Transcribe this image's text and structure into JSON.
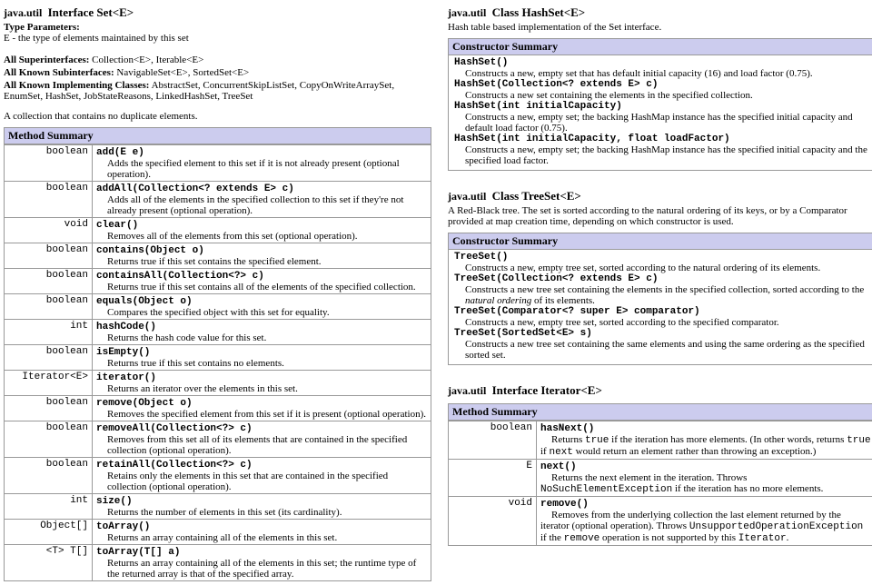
{
  "left": {
    "pkg": "java.util",
    "kind": "Interface",
    "name": "Set<E>",
    "typeParamLabel": "Type Parameters:",
    "typeParam": "E - the type of elements maintained by this set",
    "superLabel": "All Superinterfaces:",
    "superVal": "Collection<E>, Iterable<E>",
    "subLabel": "All Known Subinterfaces:",
    "subVal": "NavigableSet<E>, SortedSet<E>",
    "implLabel": "All Known Implementing Classes:",
    "implVal1": "AbstractSet, ConcurrentSkipListSet, CopyOnWriteArraySet,",
    "implVal2": "EnumSet, HashSet, JobStateReasons, LinkedHashSet, TreeSet",
    "desc": "A collection that contains no duplicate elements.",
    "methodSummary": "Method Summary",
    "m": [
      {
        "ret": "boolean",
        "sig": "add(E e)",
        "desc": "Adds the specified element to this set if it is not already present (optional operation)."
      },
      {
        "ret": "boolean",
        "sig": "addAll(Collection<? extends E> c)",
        "desc": "Adds all of the elements in the specified collection to this set if they're not already present (optional operation)."
      },
      {
        "ret": "void",
        "sig": "clear()",
        "desc": "Removes all of the elements from this set (optional operation)."
      },
      {
        "ret": "boolean",
        "sig": "contains(Object o)",
        "desc": "Returns true if this set contains the specified element."
      },
      {
        "ret": "boolean",
        "sig": "containsAll(Collection<?> c)",
        "desc": "Returns true if this set contains all of the elements of the specified collection."
      },
      {
        "ret": "boolean",
        "sig": "equals(Object o)",
        "desc": "Compares the specified object with this set for equality."
      },
      {
        "ret": "int",
        "sig": "hashCode()",
        "desc": "Returns the hash code value for this set."
      },
      {
        "ret": "boolean",
        "sig": "isEmpty()",
        "desc": "Returns true if this set contains no elements."
      },
      {
        "ret": "Iterator<E>",
        "sig": "iterator()",
        "desc": "Returns an iterator over the elements in this set."
      },
      {
        "ret": "boolean",
        "sig": "remove(Object o)",
        "desc": "Removes the specified element from this set if it is present (optional operation)."
      },
      {
        "ret": "boolean",
        "sig": "removeAll(Collection<?> c)",
        "desc": "Removes from this set all of its elements that are contained in the specified collection (optional operation)."
      },
      {
        "ret": "boolean",
        "sig": "retainAll(Collection<?> c)",
        "desc": "Retains only the elements in this set that are contained in the specified collection (optional operation)."
      },
      {
        "ret": "int",
        "sig": "size()",
        "desc": "Returns the number of elements in this set (its cardinality)."
      },
      {
        "ret": "Object[]",
        "sig": "toArray()",
        "desc": "Returns an array containing all of the elements in this set."
      },
      {
        "ret": "<T> T[]",
        "sig": "toArray(T[] a)",
        "desc": "Returns an array containing all of the elements in this set; the runtime type of the returned array is that of the specified array."
      }
    ]
  },
  "hashset": {
    "pkg": "java.util",
    "kind": "Class",
    "name": "HashSet<E>",
    "desc": "Hash table based implementation of the Set interface.",
    "csTitle": "Constructor Summary",
    "c": [
      {
        "sig": "HashSet()",
        "desc": "Constructs a new, empty set that has default initial capacity (16) and load factor (0.75)."
      },
      {
        "sig": "HashSet(Collection<? extends E> c)",
        "desc": "Constructs a new set containing the elements in the specified collection."
      },
      {
        "sig": "HashSet(int initialCapacity)",
        "desc": "Constructs a new, empty set; the backing HashMap instance has the specified initial capacity and default load factor (0.75)."
      },
      {
        "sig": "HashSet(int initialCapacity, float loadFactor)",
        "desc": "Constructs a new, empty set; the backing HashMap instance has the specified initial capacity and the specified load factor."
      }
    ]
  },
  "treeset": {
    "pkg": "java.util",
    "kind": "Class",
    "name": "TreeSet<E>",
    "desc": "A Red-Black tree. The set is sorted according to the natural ordering of its keys, or by a Comparator provided at map creation time, depending on which constructor is used.",
    "csTitle": "Constructor Summary",
    "c0sig": "TreeSet()",
    "c0desc": "Constructs a new, empty tree set, sorted according to the natural ordering of its elements.",
    "c1sig": "TreeSet(Collection<? extends E> c)",
    "c1descA": "Constructs a new tree set containing the elements in the specified collection, sorted according to the ",
    "c1descI": "natural ordering",
    "c1descB": " of its elements.",
    "c2sig": "TreeSet(Comparator<? super E> comparator)",
    "c2desc": "Constructs a new, empty tree set, sorted according to the specified comparator.",
    "c3sig": "TreeSet(SortedSet<E> s)",
    "c3desc": "Constructs a new tree set containing the same elements and using the same ordering as the specified sorted set."
  },
  "iterator": {
    "pkg": "java.util",
    "kind": "Interface",
    "name": "Iterator<E>",
    "msTitle": "Method Summary",
    "m0ret": "boolean",
    "m0sig": "hasNext()",
    "m0a": "Returns ",
    "m0b": "true",
    "m0c": " if the iteration has more elements. (In other words, returns ",
    "m0d": "true",
    "m0e": " if ",
    "m0f": "next",
    "m0g": " would return an element rather than throwing an exception.)",
    "m1ret": "E",
    "m1sig": "next()",
    "m1a": "Returns the next element in the iteration. Throws ",
    "m1b": "NoSuchElementException",
    "m1c": " if the iteration has no more elements.",
    "m2ret": "void",
    "m2sig": "remove()",
    "m2a": "Removes from the underlying collection the last element returned by the iterator (optional operation). Throws ",
    "m2b": "UnsupportedOperationException",
    "m2c": " if the ",
    "m2d": "remove",
    "m2e": " operation is not supported by this ",
    "m2f": "Iterator",
    "m2g": "."
  }
}
